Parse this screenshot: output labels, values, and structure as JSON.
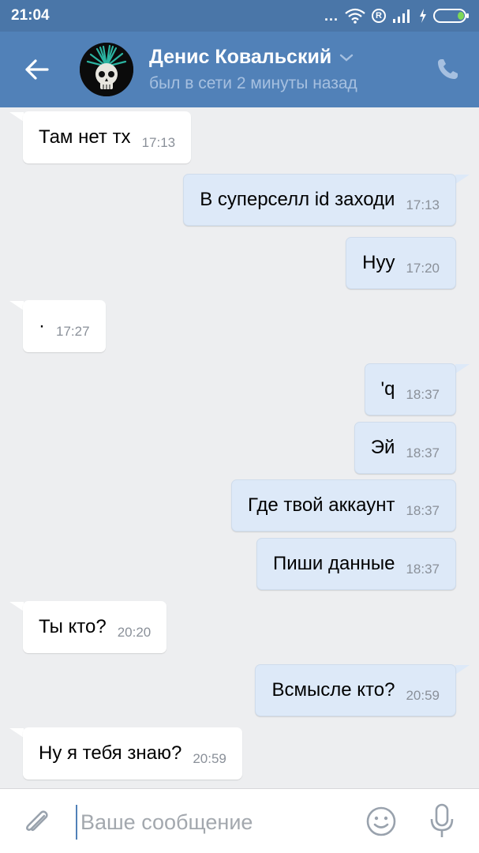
{
  "status_bar": {
    "time": "21:04",
    "dots": "...",
    "r_badge": "R"
  },
  "header": {
    "contact_name": "Денис Ковальский",
    "status": "был в сети 2 минуты назад"
  },
  "messages": [
    {
      "direction": "in",
      "text": "Там нет тх",
      "time": "17:13"
    },
    {
      "direction": "out",
      "text": "В суперселл id заходи",
      "time": "17:13"
    },
    {
      "direction": "out",
      "text": "Нуу",
      "time": "17:20"
    },
    {
      "direction": "in",
      "text": "·",
      "time": "17:27"
    },
    {
      "direction": "out",
      "text": "'q",
      "time": "18:37"
    },
    {
      "direction": "out",
      "text": "Эй",
      "time": "18:37"
    },
    {
      "direction": "out",
      "text": "Где твой аккаунт",
      "time": "18:37"
    },
    {
      "direction": "out",
      "text": "Пиши данные",
      "time": "18:37"
    },
    {
      "direction": "in",
      "text": "Ты кто?",
      "time": "20:20"
    },
    {
      "direction": "out",
      "text": "Всмысле кто?",
      "time": "20:59"
    },
    {
      "direction": "in",
      "text": "Ну я тебя знаю?",
      "time": "20:59"
    }
  ],
  "input": {
    "placeholder": "Ваше сообщение",
    "value": ""
  },
  "icons": {
    "back": "arrow-left-icon",
    "dropdown": "chevron-down-icon",
    "call": "phone-icon",
    "attach": "paperclip-icon",
    "emoji": "smiley-icon",
    "mic": "microphone-icon",
    "wifi": "wifi-icon",
    "signal": "signal-icon",
    "battery": "battery-icon"
  },
  "colors": {
    "status_bar": "#4a76a8",
    "header": "#5181b8",
    "background": "#edeef0",
    "incoming_bubble": "#ffffff",
    "outgoing_bubble": "#dde9f8"
  }
}
